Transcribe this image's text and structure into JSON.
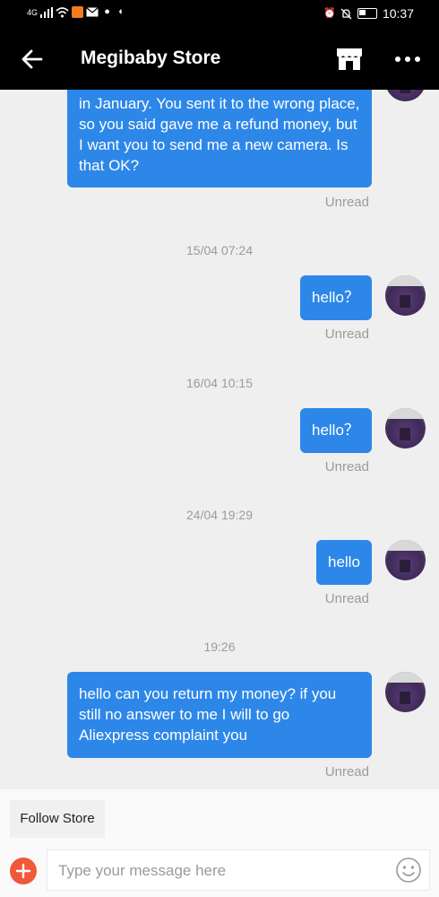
{
  "status_bar": {
    "network": "4G",
    "time": "10:37"
  },
  "header": {
    "title": "Megibaby Store"
  },
  "messages": [
    {
      "text": "in January. You sent it to the wrong place, so you said gave me a refund money, but I want you to send me a new camera. Is that OK?",
      "status": "Unread"
    },
    {
      "timestamp": "15/04 07:24",
      "text": "hello？",
      "status": "Unread"
    },
    {
      "timestamp": "16/04 10:15",
      "text": "hello？",
      "status": "Unread"
    },
    {
      "timestamp": "24/04 19:29",
      "text": "hello",
      "status": "Unread"
    },
    {
      "timestamp": "19:26",
      "text": "hello can you return my money? if you still no answer to me I will to go Aliexpress  complaint you",
      "status": "Unread"
    }
  ],
  "footer": {
    "follow_label": "Follow Store",
    "input_placeholder": "Type your message here",
    "input_value": ""
  },
  "colors": {
    "bubble": "#2d87e8",
    "accent": "#f0583a",
    "header_bg": "#000000"
  }
}
